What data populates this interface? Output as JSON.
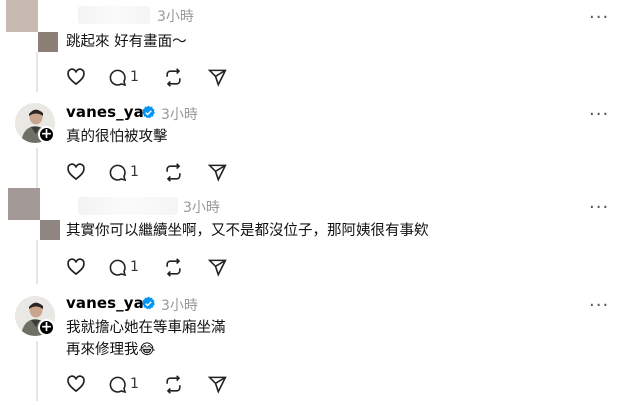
{
  "posts": [
    {
      "username": "",
      "time": "3小時",
      "text_lines": [
        "跳起來 好有畫面～"
      ],
      "reply_count": "1"
    },
    {
      "username": "vanes_yao",
      "time": "3小時",
      "text_lines": [
        "真的很怕被攻擊"
      ],
      "reply_count": "1"
    },
    {
      "username": "",
      "time": "3小時",
      "text_lines": [
        "其實你可以繼續坐啊，又不是都沒位子，那阿姨很有事欸"
      ],
      "reply_count": "1"
    },
    {
      "username": "vanes_yao",
      "time": "3小時",
      "text_lines": [
        "我就擔心她在等車廂坐滿",
        "再來修理我😂"
      ],
      "reply_count": "1"
    }
  ],
  "more_glyph": "···",
  "plus_glyph": "+",
  "icons": [
    "heart-icon",
    "comment-icon",
    "repost-icon",
    "share-icon",
    "more-icon",
    "verified-badge-icon",
    "follow-plus-icon"
  ],
  "colors": {
    "verified": "#0095f6",
    "meta": "#999999",
    "divider": "#e5e5e5"
  }
}
